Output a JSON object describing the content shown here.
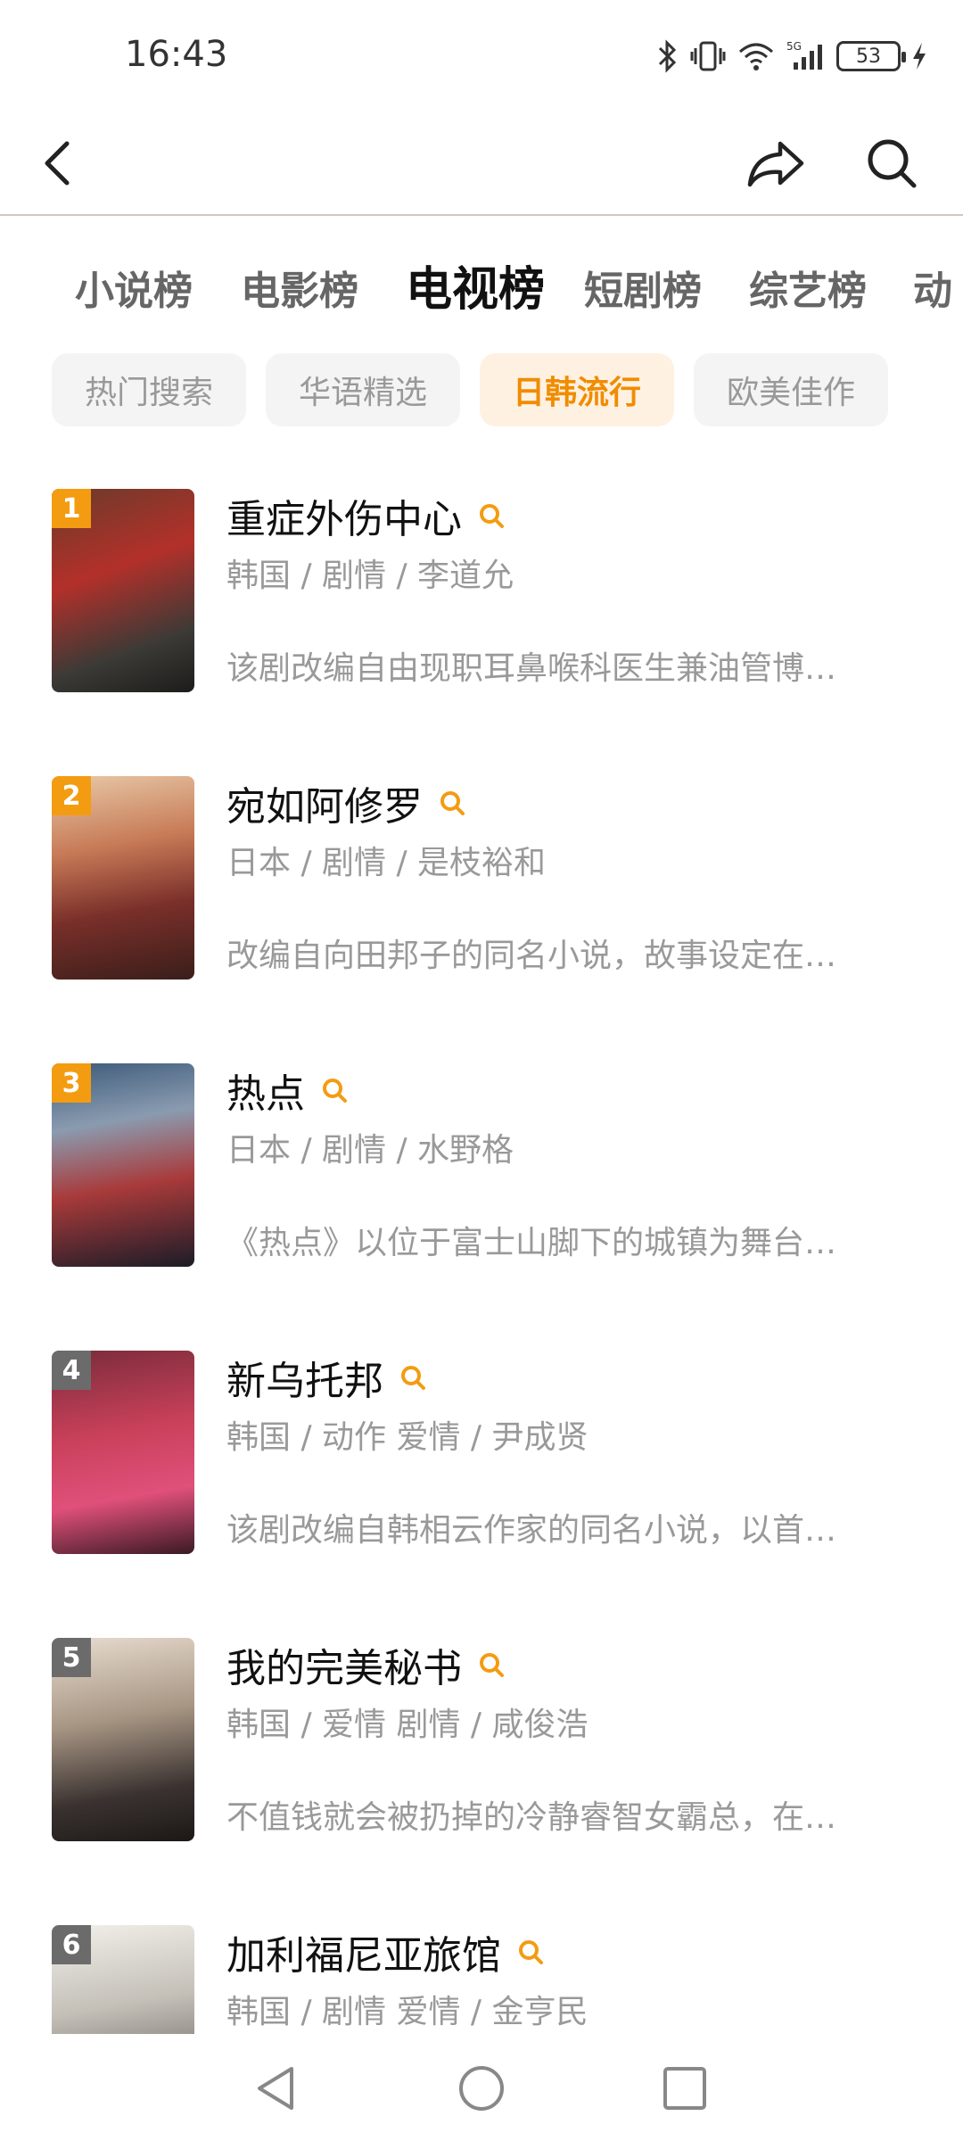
{
  "status": {
    "time": "16:43",
    "battery": "53",
    "network": "5G"
  },
  "tabs": [
    {
      "label": "小说榜"
    },
    {
      "label": "电影榜"
    },
    {
      "label": "电视榜"
    },
    {
      "label": "短剧榜"
    },
    {
      "label": "综艺榜"
    },
    {
      "label": "动"
    }
  ],
  "active_tab": "电视榜",
  "chips": [
    {
      "label": "热门搜索"
    },
    {
      "label": "华语精选"
    },
    {
      "label": "日韩流行"
    },
    {
      "label": "欧美佳作"
    }
  ],
  "active_chip": "日韩流行",
  "items": [
    {
      "rank": "1",
      "title": "重症外伤中心",
      "meta": "韩国 / 剧情 / 李道允",
      "desc": "该剧改编自由现职耳鼻喉科医生兼油管博…"
    },
    {
      "rank": "2",
      "title": "宛如阿修罗",
      "meta": "日本 / 剧情 / 是枝裕和",
      "desc": "改编自向田邦子的同名小说，故事设定在…"
    },
    {
      "rank": "3",
      "title": "热点",
      "meta": "日本 / 剧情 / 水野格",
      "desc": "《热点》以位于富士山脚下的城镇为舞台…"
    },
    {
      "rank": "4",
      "title": "新乌托邦",
      "meta": "韩国 / 动作 爱情 / 尹成贤",
      "desc": "该剧改编自韩相云作家的同名小说，以首…"
    },
    {
      "rank": "5",
      "title": "我的完美秘书",
      "meta": "韩国 / 爱情 剧情 / 咸俊浩",
      "desc": "不值钱就会被扔掉的冷静睿智女霸总，在…"
    },
    {
      "rank": "6",
      "title": "加利福尼亚旅馆",
      "meta": "韩国 / 剧情 爱情 / 金亨民",
      "desc": ""
    }
  ],
  "colors": {
    "accent": "#f39c12",
    "accent_text": "#f08c00",
    "rank_other": "#6b6b6b"
  },
  "icons": [
    "back-icon",
    "share-icon",
    "search-icon",
    "nav-back-icon",
    "nav-home-icon",
    "nav-recents-icon"
  ]
}
